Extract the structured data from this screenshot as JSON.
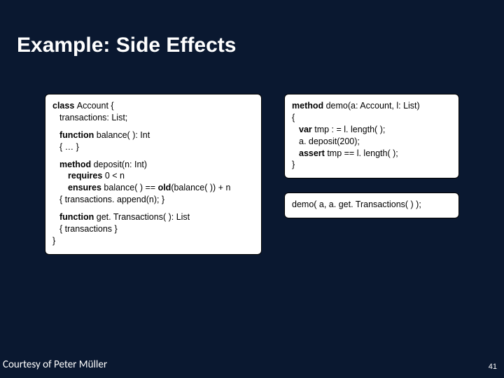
{
  "title": "Example: Side Effects",
  "left": {
    "l1a": "class ",
    "l1b": "Account {",
    "l2": "transactions: List;",
    "l3a": "function ",
    "l3b": "balance( ): Int",
    "l4": "{ … }",
    "l5a": "method ",
    "l5b": "deposit(n: Int)",
    "l6a": "requires ",
    "l6b": "0 < n",
    "l7a": "ensures ",
    "l7b": "balance( ) == ",
    "l7c": "old",
    "l7d": "(balance( )) + n",
    "l8": "{ transactions. append(n); }",
    "l9a": "function ",
    "l9b": "get. Transactions( ): List",
    "l10": "{ transactions }",
    "l11": "}"
  },
  "right1": {
    "l1a": "method ",
    "l1b": "demo(a: Account, l: List)",
    "l2": "{",
    "l3a": "var ",
    "l3b": "tmp : = l. length( );",
    "l4": "a. deposit(200);",
    "l5a": "assert ",
    "l5b": "tmp == l. length( );",
    "l6": "}"
  },
  "right2": "demo( a, a. get. Transactions( ) );",
  "footer_left": "Courtesy of Peter Müller",
  "footer_right": "41"
}
